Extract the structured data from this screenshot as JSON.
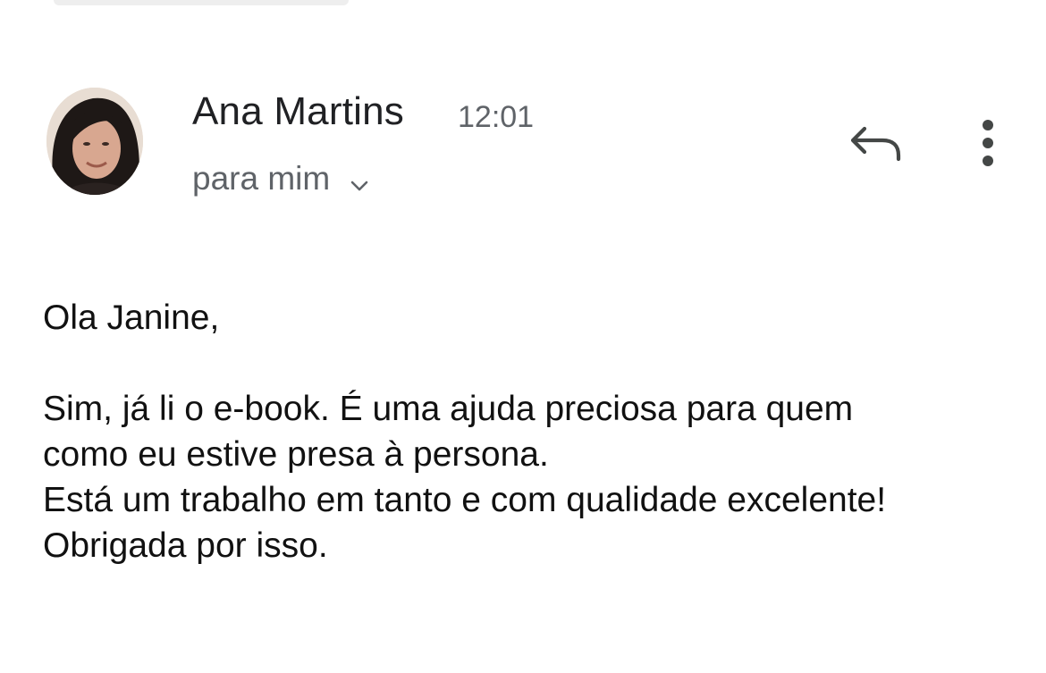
{
  "email": {
    "sender_name": "Ana Martins",
    "time": "12:01",
    "recipient": "para mim",
    "greeting": "Ola Janine,",
    "body_lines": [
      "Sim, já li o e-book. É uma ajuda preciosa para quem",
      "como eu estive presa à persona.",
      "Está um trabalho em tanto e com qualidade excelente!",
      "Obrigada por isso."
    ]
  },
  "icons": {
    "avatar": "avatar",
    "recipient_toggle": "chevron-down-icon",
    "reply": "reply-icon",
    "more": "more-vert-icon"
  },
  "colors": {
    "name": "#202124",
    "secondary": "#5f6368",
    "body": "#111111",
    "background": "#ffffff"
  }
}
